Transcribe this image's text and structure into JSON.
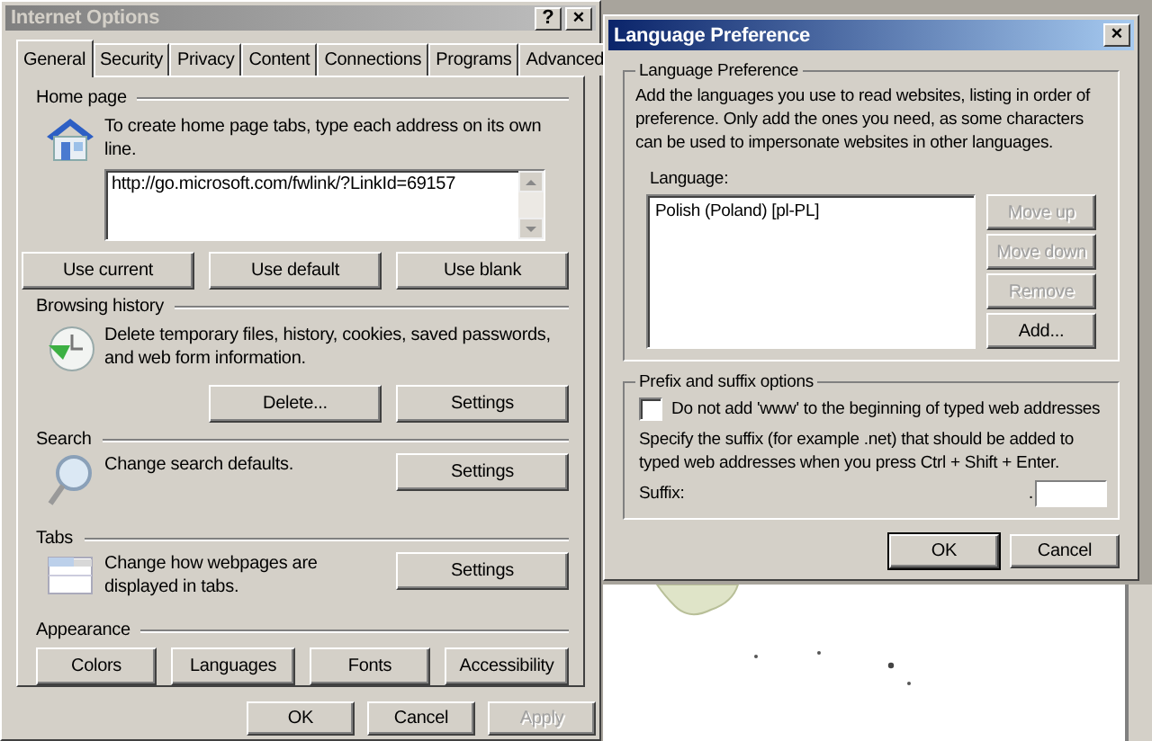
{
  "internet_options": {
    "title": "Internet Options",
    "help_button": "?",
    "close_button": "×",
    "tabs": [
      {
        "label": "General",
        "selected": true
      },
      {
        "label": "Security",
        "selected": false
      },
      {
        "label": "Privacy",
        "selected": false
      },
      {
        "label": "Content",
        "selected": false
      },
      {
        "label": "Connections",
        "selected": false
      },
      {
        "label": "Programs",
        "selected": false
      },
      {
        "label": "Advanced",
        "selected": false
      }
    ],
    "sections": [
      {
        "kind": "home",
        "heading": "Home page",
        "description": "To create home page tabs, type each address on its own line.",
        "url": "http://go.microsoft.com/fwlink/?LinkId=69157",
        "buttons": [
          "Use current",
          "Use default",
          "Use blank"
        ]
      },
      {
        "kind": "history",
        "heading": "Browsing history",
        "description": "Delete temporary files, history, cookies, saved passwords, and web form information.",
        "buttons": [
          "Delete...",
          "Settings"
        ]
      },
      {
        "kind": "search",
        "heading": "Search",
        "description": "Change search defaults.",
        "buttons": [
          "Settings"
        ]
      },
      {
        "kind": "tabs",
        "heading": "Tabs",
        "description": "Change how webpages are displayed in tabs.",
        "buttons": [
          "Settings"
        ]
      },
      {
        "kind": "appearance",
        "heading": "Appearance",
        "buttons": [
          "Colors",
          "Languages",
          "Fonts",
          "Accessibility"
        ]
      }
    ],
    "footer_buttons": [
      {
        "label": "OK",
        "disabled": false
      },
      {
        "label": "Cancel",
        "disabled": false
      },
      {
        "label": "Apply",
        "disabled": true
      }
    ]
  },
  "language_preference": {
    "title": "Language Preference",
    "close_button": "×",
    "group_heading": "Language Preference",
    "description": "Add the languages you use to read websites, listing in order of preference. Only add the ones you need, as some characters can be used to impersonate websites in other languages.",
    "list_label": "Language:",
    "languages": [
      {
        "name": "Polish (Poland) [pl-PL]",
        "selected": false
      }
    ],
    "side_buttons": [
      {
        "label": "Move up",
        "disabled": true
      },
      {
        "label": "Move down",
        "disabled": true
      },
      {
        "label": "Remove",
        "disabled": true
      },
      {
        "label": "Add...",
        "disabled": false
      }
    ],
    "prefix_heading": "Prefix and suffix options",
    "checkbox": {
      "label": "Do not add 'www' to the beginning of typed web addresses",
      "checked": false
    },
    "suffix_hint": "Specify the suffix (for example .net) that should be added to typed web addresses when you press Ctrl + Shift + Enter.",
    "suffix_label": "Suffix:",
    "suffix_dot": ".",
    "buttons": [
      {
        "label": "OK",
        "default": true
      },
      {
        "label": "Cancel",
        "default": false
      }
    ]
  }
}
